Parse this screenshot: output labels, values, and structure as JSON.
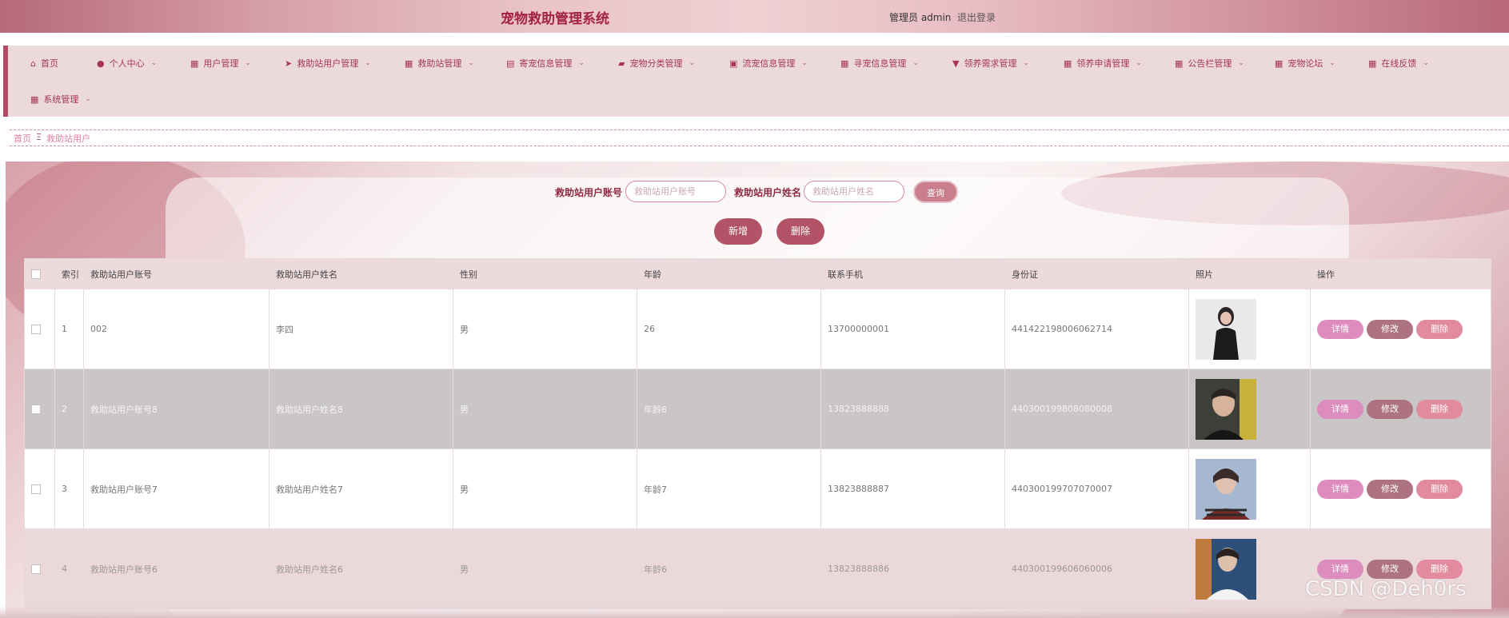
{
  "header": {
    "title": "宠物救助管理系统",
    "user": "管理员 admin",
    "logout": "退出登录"
  },
  "nav": {
    "items": [
      {
        "label": "首页",
        "icon": "home-icon",
        "chev": false
      },
      {
        "label": "个人中心",
        "icon": "user-icon",
        "chev": true
      },
      {
        "label": "用户管理",
        "icon": "grid-icon",
        "chev": true
      },
      {
        "label": "救助站用户管理",
        "icon": "send-icon",
        "chev": true
      },
      {
        "label": "救助站管理",
        "icon": "grid-icon",
        "chev": true
      },
      {
        "label": "寄宠信息管理",
        "icon": "chat-icon",
        "chev": true
      },
      {
        "label": "宠物分类管理",
        "icon": "briefcase-icon",
        "chev": true
      },
      {
        "label": "流宠信息管理",
        "icon": "clipboard-icon",
        "chev": true
      },
      {
        "label": "寻宠信息管理",
        "icon": "grid-icon",
        "chev": true
      },
      {
        "label": "领养需求管理",
        "icon": "pin-icon",
        "chev": true
      },
      {
        "label": "领养申请管理",
        "icon": "grid-icon",
        "chev": true
      },
      {
        "label": "公告栏管理",
        "icon": "grid-icon",
        "chev": true
      },
      {
        "label": "宠物论坛",
        "icon": "grid-icon",
        "chev": true
      },
      {
        "label": "在线反馈",
        "icon": "grid-icon",
        "chev": true
      },
      {
        "label": "系统管理",
        "icon": "grid-icon",
        "chev": true
      }
    ]
  },
  "breadcrumb": {
    "home": "首页",
    "sep": "Ξ",
    "current": "救助站用户"
  },
  "search": {
    "account_label": "救助站用户账号",
    "account_placeholder": "救助站用户账号",
    "name_label": "救助站用户姓名",
    "name_placeholder": "救助站用户姓名",
    "query": "查询"
  },
  "actions": {
    "add": "新增",
    "delete": "删除"
  },
  "table": {
    "headers": [
      "",
      "索引",
      "救助站用户账号",
      "救助站用户姓名",
      "性别",
      "年龄",
      "联系手机",
      "身份证",
      "照片",
      "操作"
    ],
    "rows": [
      {
        "index": "1",
        "account": "002",
        "name": "李四",
        "gender": "男",
        "age": "26",
        "phone": "13700000001",
        "idcard": "441422198006062714"
      },
      {
        "index": "2",
        "account": "救助站用户账号8",
        "name": "救助站用户姓名8",
        "gender": "男",
        "age": "年龄8",
        "phone": "13823888888",
        "idcard": "440300199808080008"
      },
      {
        "index": "3",
        "account": "救助站用户账号7",
        "name": "救助站用户姓名7",
        "gender": "男",
        "age": "年龄7",
        "phone": "13823888887",
        "idcard": "440300199707070007"
      },
      {
        "index": "4",
        "account": "救助站用户账号6",
        "name": "救助站用户姓名6",
        "gender": "男",
        "age": "年龄6",
        "phone": "13823888886",
        "idcard": "440300199606060006"
      }
    ],
    "ops": {
      "detail": "详情",
      "edit": "修改",
      "remove": "删除"
    }
  },
  "watermark": "CSDN @Deh0rs"
}
